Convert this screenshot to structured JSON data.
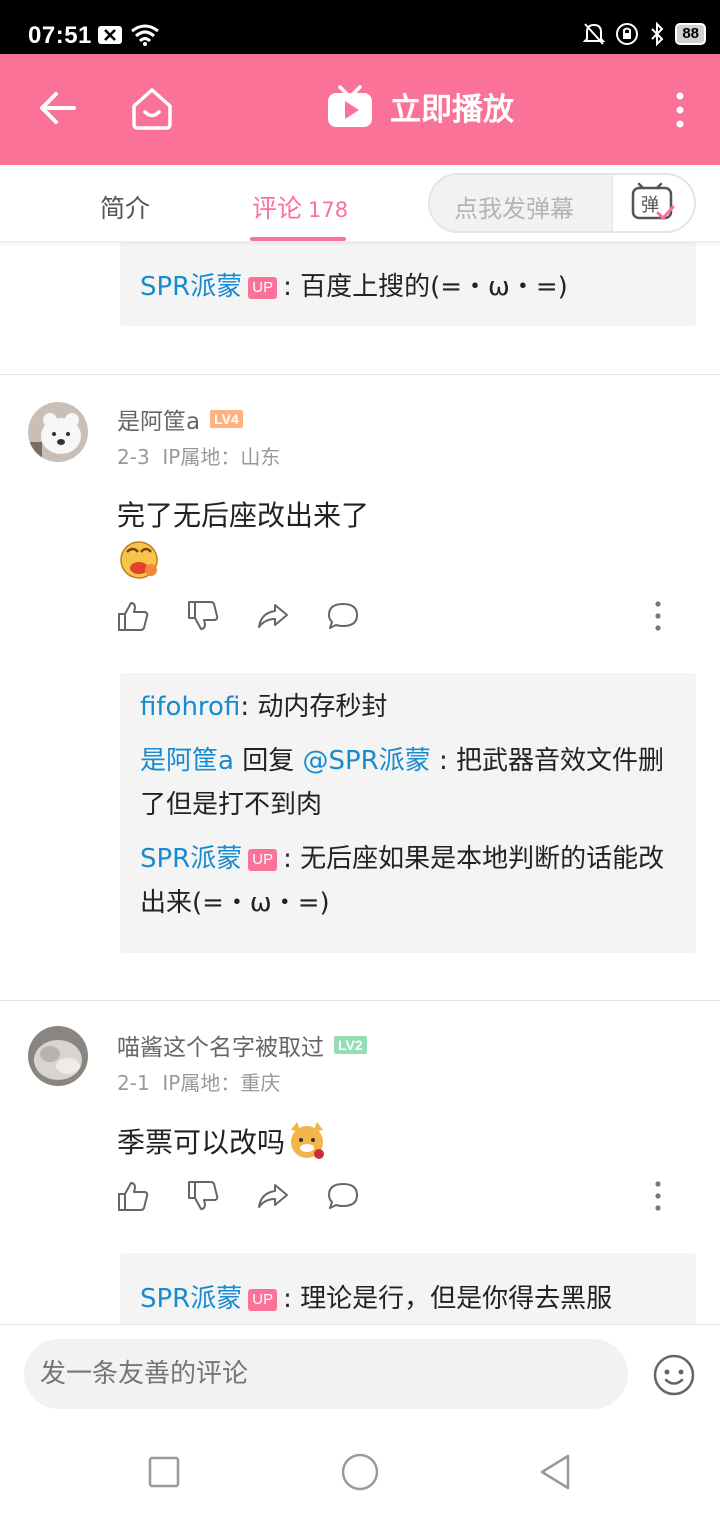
{
  "status_bar": {
    "time": "07:51",
    "battery": "88"
  },
  "app_bar": {
    "play_label": "立即播放"
  },
  "tabs": {
    "intro": "简介",
    "comments": "评论",
    "comments_count": "178"
  },
  "danmaku": {
    "placeholder": "点我发弹幕",
    "button_label": "弹"
  },
  "reply_top": {
    "author": "SPR派蒙",
    "badge": "UP",
    "text": ": 百度上搜的(=・ω・=)"
  },
  "comments": [
    {
      "author": "是阿筐a",
      "level": "LV4",
      "date": "2-3",
      "ip": "IP属地：山东",
      "text": "完了无后座改出来了",
      "replies": [
        {
          "author": "fifohrofi",
          "text": ": 动内存秒封"
        },
        {
          "author": "是阿筐a",
          "reply_word": " 回复 ",
          "mention": "@SPR派蒙",
          "text": " : 把武器音效文件删了但是打不到肉"
        },
        {
          "author": "SPR派蒙",
          "badge": "UP",
          "text": ": 无后座如果是本地判断的话能改出来(=・ω・=)"
        }
      ]
    },
    {
      "author": "喵酱这个名字被取过",
      "level": "LV2",
      "date": "2-1",
      "ip": "IP属地：重庆",
      "text": "季票可以改吗",
      "replies": [
        {
          "author": "SPR派蒙",
          "badge": "UP",
          "text": ": 理论是行，但是你得去黑服"
        }
      ]
    }
  ],
  "input": {
    "placeholder": "发一条友善的评论"
  },
  "colors": {
    "accent": "#fb7299",
    "link": "#178bcf"
  },
  "icons": [
    "back-icon",
    "home-icon",
    "tv-play-icon",
    "more-icon",
    "like-icon",
    "dislike-icon",
    "share-icon",
    "reply-icon",
    "emoji-icon"
  ]
}
